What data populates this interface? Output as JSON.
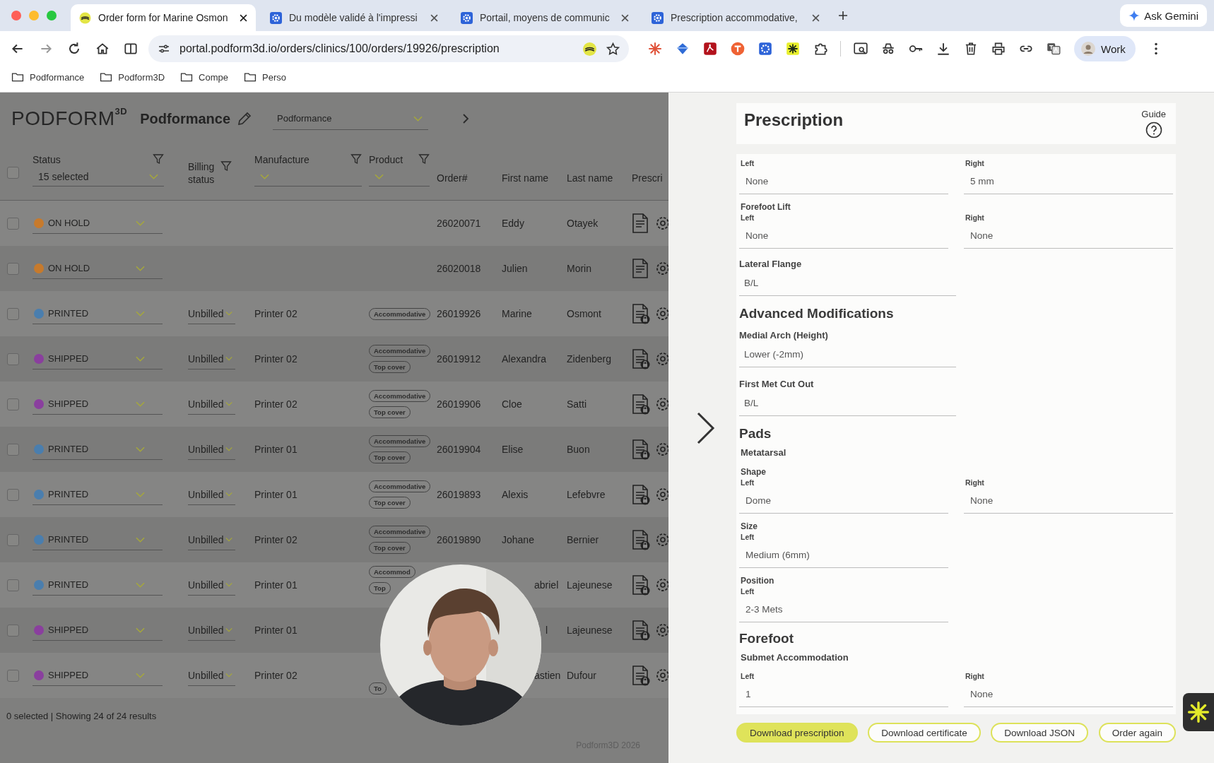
{
  "browser": {
    "tabs": [
      {
        "title": "Order form for Marine Osmon",
        "selected": true
      },
      {
        "title": "Du modèle validé à l'impressi",
        "selected": false
      },
      {
        "title": "Portail, moyens de communic",
        "selected": false
      },
      {
        "title": "Prescription accommodative,",
        "selected": false
      }
    ],
    "gemini_button": "Ask Gemini",
    "url": "portal.podform3d.io/orders/clinics/100/orders/19926/prescription",
    "profile": "Work",
    "bookmarks": [
      "Podformance",
      "Podform3D",
      "Compe",
      "Perso"
    ]
  },
  "header": {
    "logo": "PODFORM",
    "logo_sup": "3D",
    "clinic": "Podformance",
    "clinic_select": "Podformance"
  },
  "table": {
    "all_checked": false,
    "columns": [
      {
        "label": "Status",
        "kind": "select",
        "value": "15 selected"
      },
      {
        "label": "Billing status",
        "kind": "filter"
      },
      {
        "label": "Manufacture",
        "kind": "select"
      },
      {
        "label": "Product",
        "kind": "select"
      },
      {
        "label": "Order#",
        "kind": "plain"
      },
      {
        "label": "First name",
        "kind": "plain"
      },
      {
        "label": "Last name",
        "kind": "plain"
      },
      {
        "label": "Prescri",
        "kind": "plain"
      }
    ],
    "rows": [
      {
        "checked": false,
        "status": "ON HOLD",
        "color": "#c77a2c",
        "products": [],
        "order": "26020071",
        "first_name": "Eddy",
        "last_name": "Otayek",
        "locked": false
      },
      {
        "checked": false,
        "status": "ON HOLD",
        "color": "#c77a2c",
        "products": [],
        "order": "26020018",
        "first_name": "Julien",
        "last_name": "Morin",
        "locked": false
      },
      {
        "checked": false,
        "status": "PRINTED",
        "color": "#4a7eae",
        "billing": "Unbilled",
        "manufacture": "Printer 02",
        "products": [
          "Accommodative"
        ],
        "order": "26019926",
        "first_name": "Marine",
        "last_name": "Osmont",
        "locked": true
      },
      {
        "checked": false,
        "status": "SHIPPED",
        "color": "#8a3f9e",
        "billing": "Unbilled",
        "manufacture": "Printer 02",
        "products": [
          "Accommodative",
          "Top cover"
        ],
        "order": "26019912",
        "first_name": "Alexandra",
        "last_name": "Zidenberg",
        "locked": true
      },
      {
        "checked": false,
        "status": "SHIPPED",
        "color": "#8a3f9e",
        "billing": "Unbilled",
        "manufacture": "Printer 02",
        "products": [
          "Accommodative",
          "Top cover"
        ],
        "order": "26019906",
        "first_name": "Cloe",
        "last_name": "Satti",
        "locked": true
      },
      {
        "checked": false,
        "status": "PRINTED",
        "color": "#4a7eae",
        "billing": "Unbilled",
        "manufacture": "Printer 01",
        "products": [
          "Accommodative",
          "Top cover"
        ],
        "order": "26019904",
        "first_name": "Elise",
        "last_name": "Buon",
        "locked": true
      },
      {
        "checked": false,
        "status": "PRINTED",
        "color": "#4a7eae",
        "billing": "Unbilled",
        "manufacture": "Printer 01",
        "products": [
          "Accommodative",
          "Top cover"
        ],
        "order": "26019893",
        "first_name": "Alexis",
        "last_name": "Lefebvre",
        "locked": true
      },
      {
        "checked": false,
        "status": "PRINTED",
        "color": "#4a7eae",
        "billing": "Unbilled",
        "manufacture": "Printer 02",
        "products": [
          "Accommodative",
          "Top cover"
        ],
        "order": "26019890",
        "first_name": "Johane",
        "last_name": "Bernier",
        "locked": true
      },
      {
        "checked": false,
        "status": "PRINTED",
        "color": "#4a7eae",
        "billing": "Unbilled",
        "manufacture": "Printer 01",
        "products": [
          "Accommod",
          "Top"
        ],
        "first_name": "abriel",
        "last_name": "Lajeunese",
        "locked": true
      },
      {
        "checked": false,
        "status": "SHIPPED",
        "color": "#8a3f9e",
        "billing": "Unbilled",
        "manufacture": "Printer 01",
        "products": [],
        "first_name": "l",
        "last_name": "Lajeunese",
        "locked": true
      },
      {
        "checked": false,
        "status": "SHIPPED",
        "color": "#8a3f9e",
        "billing": "Unbilled",
        "manufacture": "Printer 02",
        "products": [
          "To"
        ],
        "first_name": "astien",
        "last_name": "Dufour",
        "locked": true
      }
    ],
    "footer": "0 selected | Showing 24 of 24 results",
    "copyright": "Podform3D 2026"
  },
  "prescription": {
    "title": "Prescription",
    "guide": "Guide",
    "items": [
      {
        "kind": "pair",
        "left": {
          "label": "Left",
          "value": "None"
        },
        "right": {
          "label": "Right",
          "value": "5 mm"
        }
      },
      {
        "kind": "pair",
        "title": "Forefoot Lift",
        "left": {
          "label": "Left",
          "value": "None"
        },
        "right": {
          "label": "Right",
          "value": "None"
        }
      },
      {
        "kind": "field",
        "title": "Lateral Flange",
        "value": "B/L"
      },
      {
        "kind": "heading",
        "text": "Advanced Modifications"
      },
      {
        "kind": "field",
        "title": "Medial Arch (Height)",
        "value": "Lower (-2mm)"
      },
      {
        "kind": "field",
        "title": "First Met Cut Out",
        "value": "B/L"
      },
      {
        "kind": "heading",
        "text": "Pads"
      },
      {
        "kind": "subheading",
        "text": "Metatarsal"
      },
      {
        "kind": "pair",
        "title": "Shape",
        "left": {
          "label": "Left",
          "value": "Dome"
        },
        "right": {
          "label": "Right",
          "value": "None"
        }
      },
      {
        "kind": "pair",
        "title": "Size",
        "left": {
          "label": "Left",
          "value": "Medium (6mm)"
        }
      },
      {
        "kind": "pair",
        "title": "Position",
        "left": {
          "label": "Left",
          "value": "2-3 Mets"
        }
      },
      {
        "kind": "heading",
        "text": "Forefoot"
      },
      {
        "kind": "subheading",
        "text": "Submet Accommodation"
      },
      {
        "kind": "pair",
        "left": {
          "label": "Left",
          "value": "1"
        },
        "right": {
          "label": "Right",
          "value": "None"
        }
      }
    ],
    "buttons": [
      {
        "label": "Download prescription",
        "kind": "primary"
      },
      {
        "label": "Download certificate",
        "kind": "outline"
      },
      {
        "label": "Download JSON",
        "kind": "outline"
      },
      {
        "label": "Order again",
        "kind": "outline"
      }
    ]
  }
}
